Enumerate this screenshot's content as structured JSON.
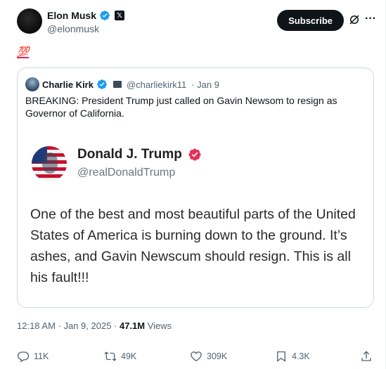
{
  "post": {
    "author_name": "Elon Musk",
    "author_handle": "@elonmusk",
    "subscribe_label": "Subscribe",
    "more_label": "···",
    "text": "💯",
    "timestamp": "12:18 AM · Jan 9, 2025 · ",
    "views_count": "47.1M",
    "views_label": " Views"
  },
  "quote": {
    "author_name": "Charlie Kirk",
    "author_handle": "@charliekirk11",
    "date": "· Jan 9",
    "text": "BREAKING: President Trump just called on Gavin Newsom to resign as Governor of California.",
    "media": {
      "name": "Donald J. Trump",
      "handle": "@realDonaldTrump",
      "text": "One of the best and most beautiful parts of the United States of America is burning down to the ground. It’s ashes, and Gavin Newscum should resign. This is all his fault!!!"
    }
  },
  "actions": {
    "replies": "11K",
    "reposts": "49K",
    "likes": "309K",
    "bookmarks": "4.3K"
  },
  "colors": {
    "verified_blue": "#1d9bf0",
    "truth_badge": "#e3325a",
    "secondary_text": "#536471",
    "border": "#cfd9de"
  }
}
